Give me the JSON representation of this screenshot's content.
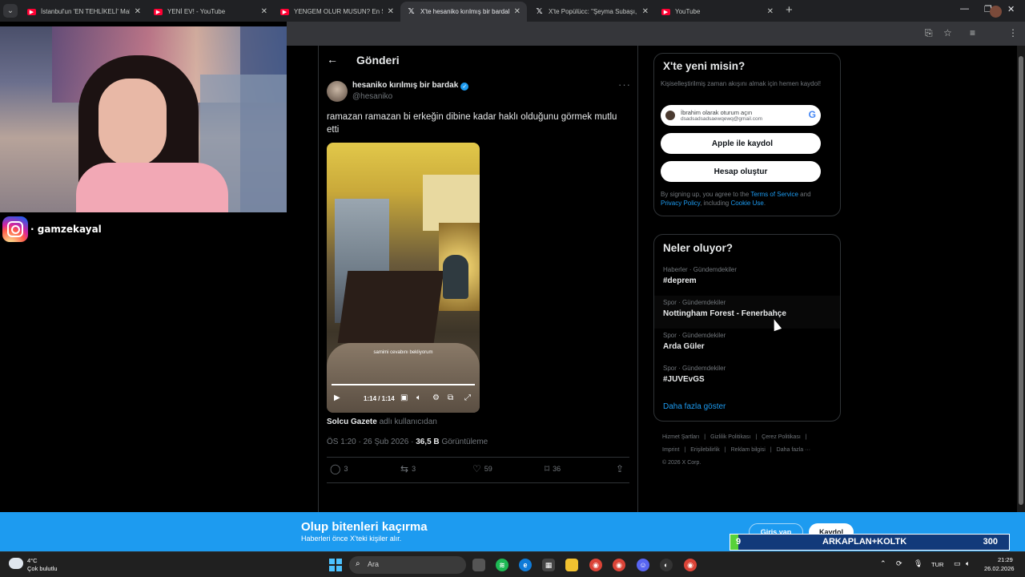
{
  "browser": {
    "tabs": [
      {
        "label": "İstanbul'un 'EN TEHLİKELİ' Mah",
        "icon": "youtube-icon"
      },
      {
        "label": "YENİ EV! - YouTube",
        "icon": "youtube-icon"
      },
      {
        "label": "YENGEM OLUR MUSUN? En Sa",
        "icon": "youtube-icon"
      },
      {
        "label": "X'te hesaniko kırılmış bir bardak",
        "icon": "x-icon",
        "active": true
      },
      {
        "label": "X'te Popülücc: \"Şeyma Subaşı, k",
        "icon": "x-icon"
      },
      {
        "label": "YouTube",
        "icon": "youtube-icon"
      }
    ],
    "new_tab": "+",
    "window_controls": {
      "minimize": "—",
      "maximize": "❐",
      "close": "✕"
    }
  },
  "overlay": {
    "instagram_handle": "· gamzekayal"
  },
  "post": {
    "header_title": "Gönderi",
    "author_name": "hesaniko kırılmış bir bardak",
    "author_handle": "@hesaniko",
    "text": "ramazan ramazan bi erkeğin dibine kadar haklı olduğunu görmek mutlu etti",
    "video": {
      "caption": "samimi cevabını bekliyorum",
      "time": "1:14 / 1:14",
      "progress": 1.0
    },
    "source_name": "Solcu Gazete",
    "source_suffix": "adlı kullanıcıdan",
    "timestamp": "ÖS 1:20 · 26 Şub 2026 · ",
    "views": "36,5 B",
    "views_label": "Görüntüleme",
    "actions": {
      "replies": "3",
      "reposts": "3",
      "likes": "59",
      "bookmarks": "36"
    }
  },
  "sidebar": {
    "signup_card": {
      "title": "X'te yeni misin?",
      "description": "Kişiselleştirilmiş zaman akışını almak için hemen kaydol!",
      "google_name": "İbrahim olarak oturum açın",
      "google_email": "dsadsadsadsaewqewq@gmail.com",
      "apple_label": "Apple ile kaydol",
      "create_label": "Hesap oluştur",
      "terms_prefix": "By signing up, you agree to the ",
      "terms_link": "Terms of Service",
      "terms_and": " and ",
      "privacy_link": "Privacy Policy",
      "terms_including": ", including ",
      "cookie_link": "Cookie Use",
      "terms_end": "."
    },
    "trends_card": {
      "title": "Neler oluyor?",
      "items": [
        {
          "category": "Haberler · Gündemdekiler",
          "name": "#deprem"
        },
        {
          "category": "Spor · Gündemdekiler",
          "name": "Nottingham Forest - Fenerbahçe"
        },
        {
          "category": "Spor · Gündemdekiler",
          "name": "Arda Güler"
        },
        {
          "category": "Spor · Gündemdekiler",
          "name": "#JUVEvGS"
        }
      ],
      "show_more": "Daha fazla göster"
    },
    "footer": {
      "links": [
        "Hizmet Şartları",
        "|",
        "Gizlilik Politikası",
        "|",
        "Çerez Politikası",
        "|",
        "Imprint",
        "|",
        "Erişilebilirlik",
        "|",
        "Reklam bilgisi",
        "|",
        "Daha fazla ···"
      ],
      "copyright": "© 2026 X Corp."
    }
  },
  "banner": {
    "title": "Olup bitenleri kaçırma",
    "subtitle": "Haberleri önce X'teki kişiler alır.",
    "login": "Giriş yap",
    "signup": "Kaydol"
  },
  "goal_bar": {
    "start": "9",
    "label": "ARKAPLAN+KOLTK",
    "end": "300",
    "fill_fraction": 0.03
  },
  "taskbar": {
    "weather_temp": "4°C",
    "weather_desc": "Çok bulutlu",
    "search_placeholder": "Ara",
    "lang": "TUR",
    "time": "21:29",
    "date": "26.02.2026"
  },
  "colors": {
    "accent": "#1d9bf0",
    "background": "#000000",
    "text": "#e7e9ea",
    "muted": "#71767b"
  }
}
